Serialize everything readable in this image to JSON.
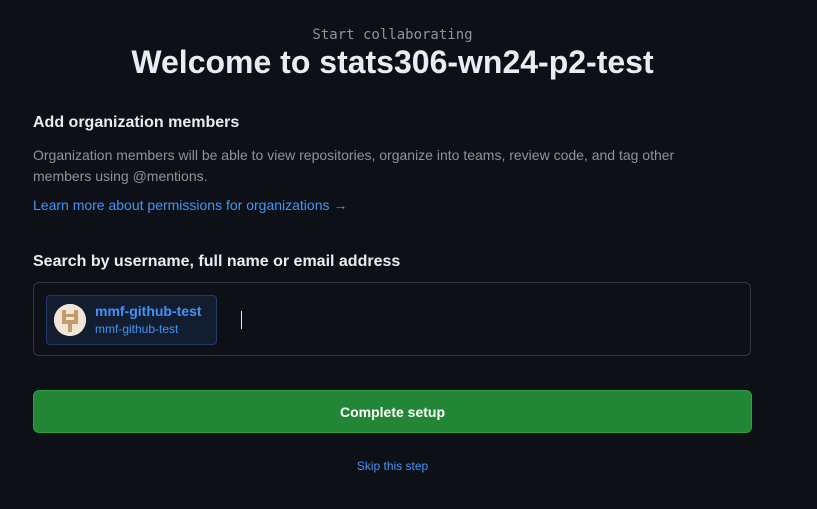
{
  "header": {
    "kicker": "Start collaborating",
    "title": "Welcome to stats306-wn24-p2-test"
  },
  "members_section": {
    "title": "Add organization members",
    "description": "Organization members will be able to view repositories, organize into teams, review code, and tag other members using @mentions.",
    "learn_more_link": "Learn more about permissions for organizations →"
  },
  "search": {
    "label": "Search by username, full name or email address",
    "input_value": "",
    "selected_members": [
      {
        "name": "mmf-github-test",
        "login": "mmf-github-test",
        "avatar_icon": "identicon-avatar"
      }
    ]
  },
  "actions": {
    "complete_label": "Complete setup",
    "skip_label": "Skip this step"
  },
  "colors": {
    "background": "#0d1117",
    "link": "#4493f8",
    "primary_button": "#238636",
    "avatar_pattern": "#c79a6b"
  }
}
